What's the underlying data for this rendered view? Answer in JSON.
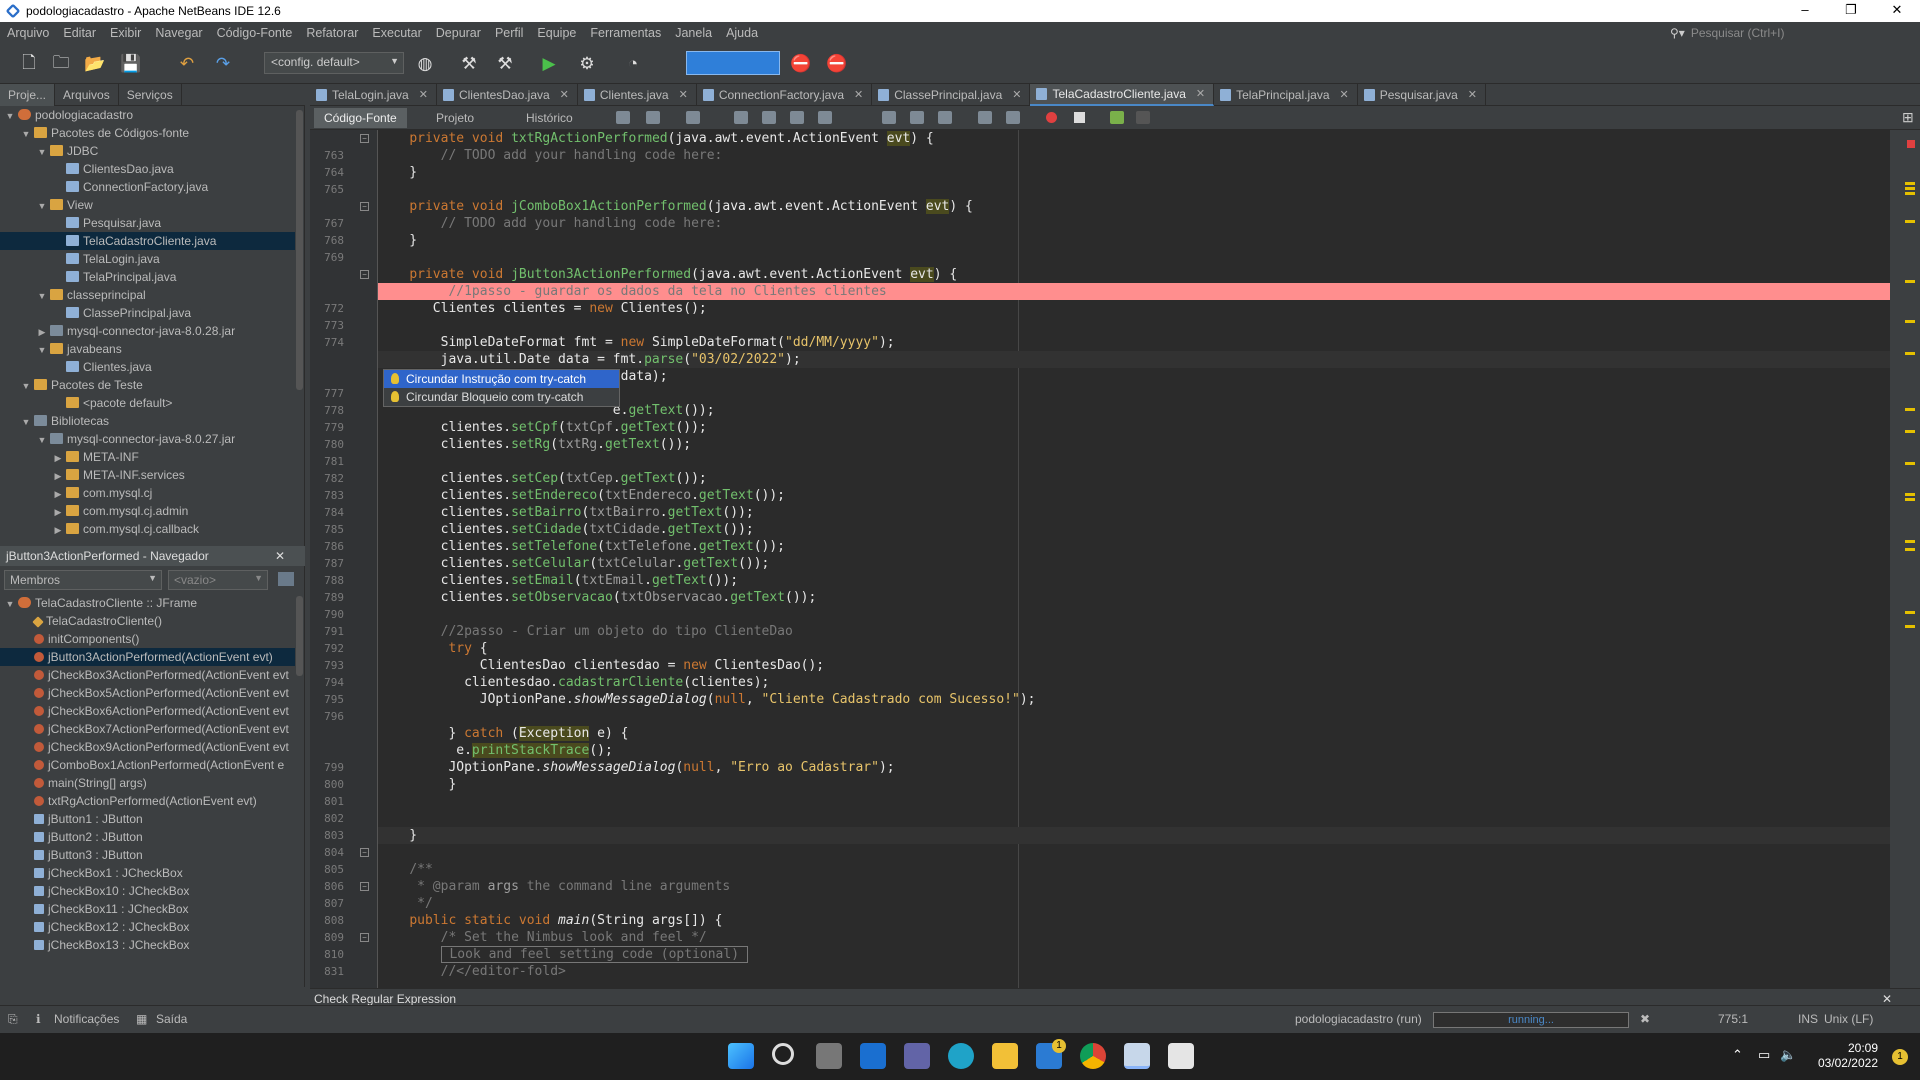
{
  "window": {
    "title": "podologiacadastro - Apache NetBeans IDE 12.6",
    "minimize": "–",
    "maximize": "❐",
    "close": "✕"
  },
  "menu": [
    "Arquivo",
    "Editar",
    "Exibir",
    "Navegar",
    "Código-Fonte",
    "Refatorar",
    "Executar",
    "Depurar",
    "Perfil",
    "Equipe",
    "Ferramentas",
    "Janela",
    "Ajuda"
  ],
  "search": {
    "placeholder": "Pesquisar (Ctrl+I)"
  },
  "toolbar": {
    "config": "<config. default>"
  },
  "panels": {
    "tabs": [
      "Proje...",
      "Arquivos",
      "Serviços"
    ]
  },
  "project_tree": [
    {
      "label": "podologiacadastro",
      "indent": 0,
      "exp": "▼",
      "icon": "proj"
    },
    {
      "label": "Pacotes de Códigos-fonte",
      "indent": 1,
      "exp": "▼",
      "icon": "pkg"
    },
    {
      "label": "JDBC",
      "indent": 2,
      "exp": "▼",
      "icon": "pkg"
    },
    {
      "label": "ClientesDao.java",
      "indent": 3,
      "exp": "",
      "icon": "java"
    },
    {
      "label": "ConnectionFactory.java",
      "indent": 3,
      "exp": "",
      "icon": "java"
    },
    {
      "label": "View",
      "indent": 2,
      "exp": "▼",
      "icon": "pkg"
    },
    {
      "label": "Pesquisar.java",
      "indent": 3,
      "exp": "",
      "icon": "java"
    },
    {
      "label": "TelaCadastroCliente.java",
      "indent": 3,
      "exp": "",
      "icon": "java",
      "selected": true
    },
    {
      "label": "TelaLogin.java",
      "indent": 3,
      "exp": "",
      "icon": "java"
    },
    {
      "label": "TelaPrincipal.java",
      "indent": 3,
      "exp": "",
      "icon": "java"
    },
    {
      "label": "classeprincipal",
      "indent": 2,
      "exp": "▼",
      "icon": "pkg"
    },
    {
      "label": "ClassePrincipal.java",
      "indent": 3,
      "exp": "",
      "icon": "java"
    },
    {
      "label": "mysql-connector-java-8.0.28.jar",
      "indent": 2,
      "exp": "▶",
      "icon": "lib"
    },
    {
      "label": "javabeans",
      "indent": 2,
      "exp": "▼",
      "icon": "pkg"
    },
    {
      "label": "Clientes.java",
      "indent": 3,
      "exp": "",
      "icon": "java"
    },
    {
      "label": "Pacotes de Teste",
      "indent": 1,
      "exp": "▼",
      "icon": "pkg"
    },
    {
      "label": "<pacote default>",
      "indent": 3,
      "exp": "",
      "icon": "pkg"
    },
    {
      "label": "Bibliotecas",
      "indent": 1,
      "exp": "▼",
      "icon": "lib"
    },
    {
      "label": "mysql-connector-java-8.0.27.jar",
      "indent": 2,
      "exp": "▼",
      "icon": "lib"
    },
    {
      "label": "META-INF",
      "indent": 3,
      "exp": "▶",
      "icon": "pkg"
    },
    {
      "label": "META-INF.services",
      "indent": 3,
      "exp": "▶",
      "icon": "pkg"
    },
    {
      "label": "com.mysql.cj",
      "indent": 3,
      "exp": "▶",
      "icon": "pkg"
    },
    {
      "label": "com.mysql.cj.admin",
      "indent": 3,
      "exp": "▶",
      "icon": "pkg"
    },
    {
      "label": "com.mysql.cj.callback",
      "indent": 3,
      "exp": "▶",
      "icon": "pkg"
    }
  ],
  "navigator": {
    "title": "jButton3ActionPerformed - Navegador",
    "filter": "Membros",
    "empty": "<vazio>",
    "items": [
      {
        "label": "TelaCadastroCliente :: JFrame",
        "indent": 0,
        "exp": "▼",
        "icon": "proj"
      },
      {
        "label": "TelaCadastroCliente()",
        "indent": 1,
        "exp": "",
        "icon": "ctor"
      },
      {
        "label": "initComponents()",
        "indent": 1,
        "exp": "",
        "icon": "meth"
      },
      {
        "label": "jButton3ActionPerformed(ActionEvent evt)",
        "indent": 1,
        "exp": "",
        "icon": "meth",
        "selected": true
      },
      {
        "label": "jCheckBox3ActionPerformed(ActionEvent evt",
        "indent": 1,
        "exp": "",
        "icon": "meth"
      },
      {
        "label": "jCheckBox5ActionPerformed(ActionEvent evt",
        "indent": 1,
        "exp": "",
        "icon": "meth"
      },
      {
        "label": "jCheckBox6ActionPerformed(ActionEvent evt",
        "indent": 1,
        "exp": "",
        "icon": "meth"
      },
      {
        "label": "jCheckBox7ActionPerformed(ActionEvent evt",
        "indent": 1,
        "exp": "",
        "icon": "meth"
      },
      {
        "label": "jCheckBox9ActionPerformed(ActionEvent evt",
        "indent": 1,
        "exp": "",
        "icon": "meth"
      },
      {
        "label": "jComboBox1ActionPerformed(ActionEvent e",
        "indent": 1,
        "exp": "",
        "icon": "meth"
      },
      {
        "label": "main(String[] args)",
        "indent": 1,
        "exp": "",
        "icon": "meth"
      },
      {
        "label": "txtRgActionPerformed(ActionEvent evt)",
        "indent": 1,
        "exp": "",
        "icon": "meth"
      },
      {
        "label": "jButton1 : JButton",
        "indent": 1,
        "exp": "",
        "icon": "field"
      },
      {
        "label": "jButton2 : JButton",
        "indent": 1,
        "exp": "",
        "icon": "field"
      },
      {
        "label": "jButton3 : JButton",
        "indent": 1,
        "exp": "",
        "icon": "field"
      },
      {
        "label": "jCheckBox1 : JCheckBox",
        "indent": 1,
        "exp": "",
        "icon": "field"
      },
      {
        "label": "jCheckBox10 : JCheckBox",
        "indent": 1,
        "exp": "",
        "icon": "field"
      },
      {
        "label": "jCheckBox11 : JCheckBox",
        "indent": 1,
        "exp": "",
        "icon": "field"
      },
      {
        "label": "jCheckBox12 : JCheckBox",
        "indent": 1,
        "exp": "",
        "icon": "field"
      },
      {
        "label": "jCheckBox13 : JCheckBox",
        "indent": 1,
        "exp": "",
        "icon": "field"
      }
    ]
  },
  "editor_tabs": [
    {
      "label": "TelaLogin.java"
    },
    {
      "label": "ClientesDao.java"
    },
    {
      "label": "Clientes.java"
    },
    {
      "label": "ConnectionFactory.java"
    },
    {
      "label": "ClassePrincipal.java"
    },
    {
      "label": "TelaCadastroCliente.java",
      "active": true
    },
    {
      "label": "TelaPrincipal.java"
    },
    {
      "label": "Pesquisar.java"
    }
  ],
  "view_tabs": {
    "source": "Código-Fonte",
    "project": "Projeto",
    "history": "Histórico"
  },
  "code_lines": [
    {
      "n": "",
      "html": "    <span class=\"kw\">private void</span> <span class=\"mt\">txtRgActionPerformed</span>(java.awt.event.ActionEvent <span class=\"hl\">evt</span>) {"
    },
    {
      "n": "763",
      "html": "        <span class=\"cm\">// TODO add your handling code here:</span>"
    },
    {
      "n": "764",
      "html": "    }"
    },
    {
      "n": "765",
      "html": ""
    },
    {
      "n": "",
      "html": "    <span class=\"kw\">private void</span> <span class=\"mt\">jComboBox1ActionPerformed</span>(java.awt.event.ActionEvent <span class=\"hl\">evt</span>) {"
    },
    {
      "n": "767",
      "html": "        <span class=\"cm\">// TODO add your handling code here:</span>"
    },
    {
      "n": "768",
      "html": "    }"
    },
    {
      "n": "769",
      "html": ""
    },
    {
      "n": "",
      "html": "    <span class=\"kw\">private void</span> <span class=\"mt\">jButton3ActionPerformed</span>(java.awt.event.ActionEvent <span class=\"hl\">evt</span>) {"
    },
    {
      "n": "",
      "html": "         <span class=\"cm\">//1passo - guardar os dados da tela no Clientes clientes</span>",
      "err": true
    },
    {
      "n": "772",
      "html": "       Clientes clientes = <span class=\"kw\">new</span> Clientes();"
    },
    {
      "n": "773",
      "html": ""
    },
    {
      "n": "774",
      "html": "        SimpleDateFormat fmt = <span class=\"kw\">new</span> SimpleDateFormat(<span class=\"st\">\"dd/MM/yyyy\"</span>);"
    },
    {
      "n": "",
      "html": "        java.util.Date data = fmt.<span class=\"mt\">parse</span>(<span class=\"st\">\"03/02/2022\"</span>);",
      "cur": true
    },
    {
      "n": "",
      "html": "                              (data);"
    },
    {
      "n": "777",
      "html": ""
    },
    {
      "n": "778",
      "html": "                              e.<span class=\"mt\">getText</span>());"
    },
    {
      "n": "779",
      "html": "        clientes.<span class=\"mt\">setCpf</span>(<span class=\"pm\">txtCpf</span>.<span class=\"mt\">getText</span>());"
    },
    {
      "n": "780",
      "html": "        clientes.<span class=\"mt\">setRg</span>(<span class=\"pm\">txtRg</span>.<span class=\"mt\">getText</span>());"
    },
    {
      "n": "781",
      "html": ""
    },
    {
      "n": "782",
      "html": "        clientes.<span class=\"mt\">setCep</span>(<span class=\"pm\">txtCep</span>.<span class=\"mt\">getText</span>());"
    },
    {
      "n": "783",
      "html": "        clientes.<span class=\"mt\">setEndereco</span>(<span class=\"pm\">txtEndereco</span>.<span class=\"mt\">getText</span>());"
    },
    {
      "n": "784",
      "html": "        clientes.<span class=\"mt\">setBairro</span>(<span class=\"pm\">txtBairro</span>.<span class=\"mt\">getText</span>());"
    },
    {
      "n": "785",
      "html": "        clientes.<span class=\"mt\">setCidade</span>(<span class=\"pm\">txtCidade</span>.<span class=\"mt\">getText</span>());"
    },
    {
      "n": "786",
      "html": "        clientes.<span class=\"mt\">setTelefone</span>(<span class=\"pm\">txtTelefone</span>.<span class=\"mt\">getText</span>());"
    },
    {
      "n": "787",
      "html": "        clientes.<span class=\"mt\">setCelular</span>(<span class=\"pm\">txtCelular</span>.<span class=\"mt\">getText</span>());"
    },
    {
      "n": "788",
      "html": "        clientes.<span class=\"mt\">setEmail</span>(<span class=\"pm\">txtEmail</span>.<span class=\"mt\">getText</span>());"
    },
    {
      "n": "789",
      "html": "        clientes.<span class=\"mt\">setObservacao</span>(<span class=\"pm\">txtObservacao</span>.<span class=\"mt\">getText</span>());"
    },
    {
      "n": "790",
      "html": ""
    },
    {
      "n": "791",
      "html": "        <span class=\"cm\">//2passo - Criar um objeto do tipo ClienteDao</span>"
    },
    {
      "n": "792",
      "html": "         <span class=\"kw\">try</span> {"
    },
    {
      "n": "793",
      "html": "             ClientesDao clientesdao = <span class=\"kw\">new</span> ClientesDao();"
    },
    {
      "n": "794",
      "html": "           clientesdao.<span class=\"mt\">cadastrarCliente</span>(clientes);"
    },
    {
      "n": "795",
      "html": "             JOptionPane.<span class=\"it\">showMessageDialog</span>(<span class=\"kw\">null</span>, <span class=\"st\">\"Cliente Cadastrado com Sucesso!\"</span>);"
    },
    {
      "n": "796",
      "html": ""
    },
    {
      "n": "",
      "html": "         } <span class=\"kw\">catch</span> (<span class=\"hl\">Exception</span> e) {"
    },
    {
      "n": "",
      "html": "          e.<span class=\"mt hl\">printStackTrace</span>();"
    },
    {
      "n": "799",
      "html": "         JOptionPane.<span class=\"it\">showMessageDialog</span>(<span class=\"kw\">null</span>, <span class=\"st\">\"Erro ao Cadastrar\"</span>);"
    },
    {
      "n": "800",
      "html": "         }"
    },
    {
      "n": "801",
      "html": ""
    },
    {
      "n": "802",
      "html": ""
    },
    {
      "n": "803",
      "html": "    }",
      "cur": true
    },
    {
      "n": "804",
      "html": ""
    },
    {
      "n": "805",
      "html": "    <span class=\"cm\">/**</span>"
    },
    {
      "n": "806",
      "html": "     <span class=\"cm\">* @param</span> <span class=\"pm\">args</span> <span class=\"cm\">the command line arguments</span>"
    },
    {
      "n": "807",
      "html": "     <span class=\"cm\">*/</span>"
    },
    {
      "n": "808",
      "html": "    <span class=\"kw\">public static void</span> <span class=\"it\">main</span>(String args[]) {"
    },
    {
      "n": "809",
      "html": "        <span class=\"cm\">/* Set the Nimbus look and feel */</span>"
    },
    {
      "n": "810",
      "html": "        <span class=\"cm\" style=\"border:1px solid #777\"> Look and feel setting code (optional) </span>"
    },
    {
      "n": "831",
      "html": "        <span class=\"cm\">//&lt;/editor-fold&gt;</span>"
    }
  ],
  "hint_popup": {
    "items": [
      "Circundar Instrução com try-catch",
      "Circundar Bloqueio com try-catch"
    ]
  },
  "output": {
    "title": "Check Regular Expression"
  },
  "status": {
    "notifications": "Notificações",
    "output": "Saída",
    "run": "podologiacadastro (run)",
    "progress_label": "running...",
    "position": "775:1",
    "mode": "INS",
    "line_ending": "Unix (LF)"
  },
  "taskbar": {
    "time": "20:09",
    "date": "03/02/2022",
    "mail_badge": "1",
    "notif_badge": "1"
  }
}
